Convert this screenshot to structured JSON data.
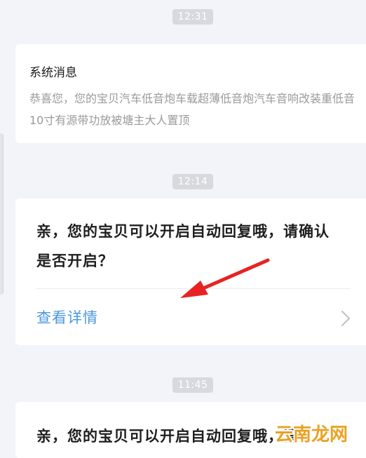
{
  "feed": {
    "groups": [
      {
        "time": "12:31",
        "title": "系统消息",
        "body": "恭喜您，您的宝贝汽车低音炮车载超薄低音炮汽车音响改装重低音10寸有源带功放被塘主大人置顶"
      },
      {
        "time": "12:14",
        "body": "亲，您的宝贝可以开启自动回复哦，请确认是否开启？",
        "link": "查看详情"
      },
      {
        "time": "11:45",
        "body": "亲，您的宝贝可以开启自动回复哦，请"
      }
    ]
  },
  "colors": {
    "background": "#f3f4f9",
    "card": "#ffffff",
    "link": "#4c98de",
    "arrow": "#e82222",
    "time_badge": "#d8d9de"
  },
  "watermark": {
    "text": "云南龙网"
  }
}
